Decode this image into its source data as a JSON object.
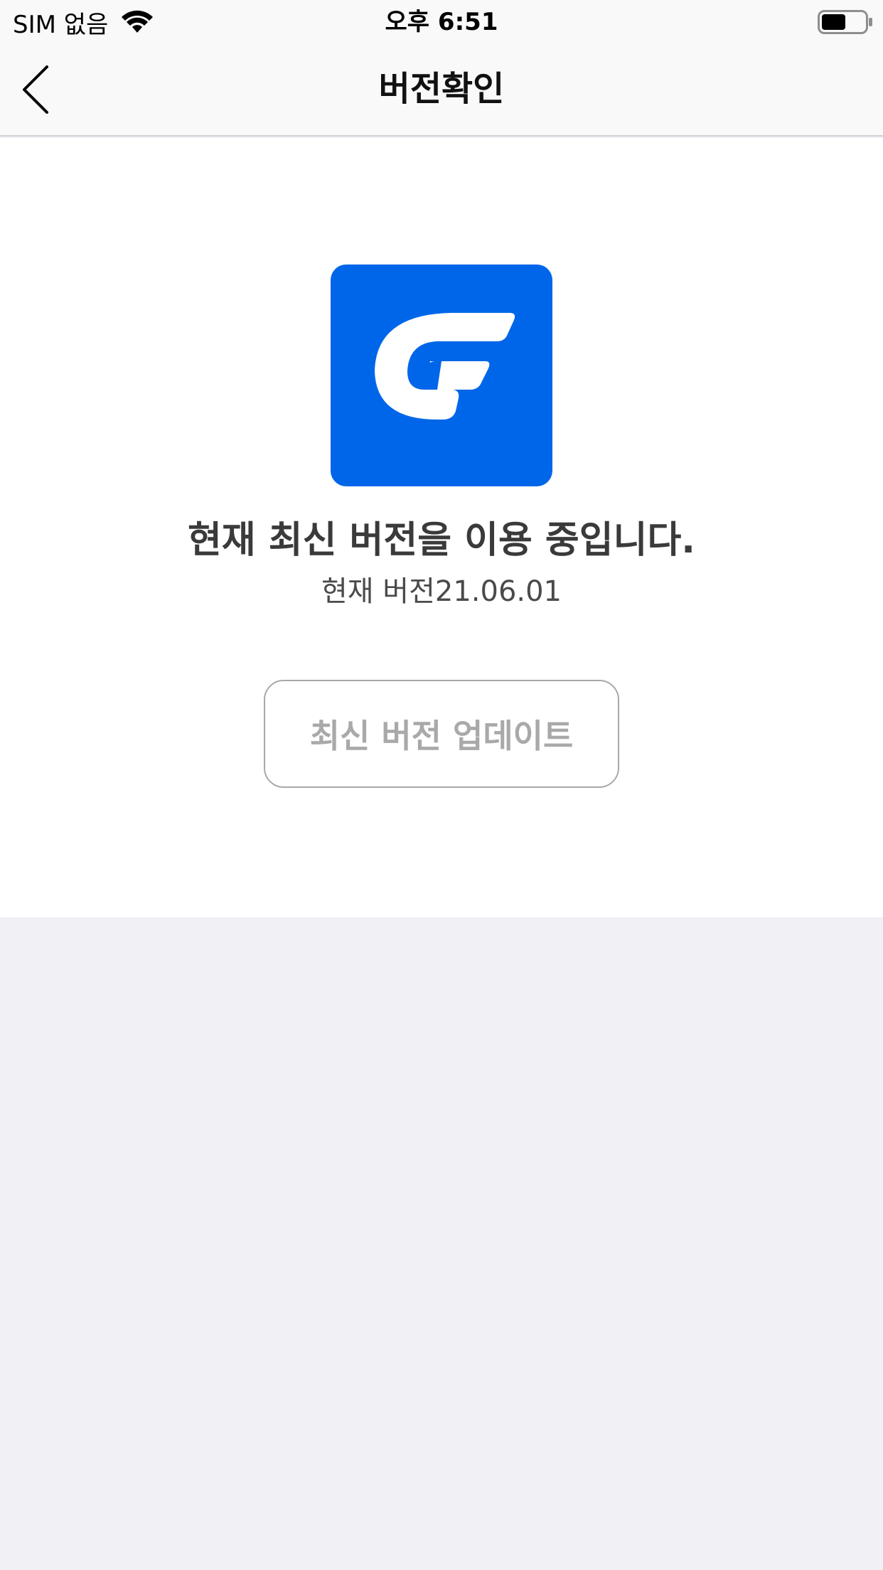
{
  "status_bar": {
    "carrier": "SIM 없음",
    "time": "오후 6:51",
    "icons": [
      "wifi-icon",
      "battery-icon"
    ],
    "battery_level": 0.55
  },
  "nav": {
    "title": "버전확인",
    "back_icon": "chevron-left-icon"
  },
  "main": {
    "app_icon": "app-logo-icon",
    "headline": "현재 최신 버전을 이용 중입니다.",
    "version_text": "현재 버전21.06.01",
    "update_button_label": "최신 버전 업데이트"
  },
  "colors": {
    "brand_blue": "#0066e9",
    "background_gray": "#f0f0f5",
    "disabled_text": "#a9a9a9"
  }
}
